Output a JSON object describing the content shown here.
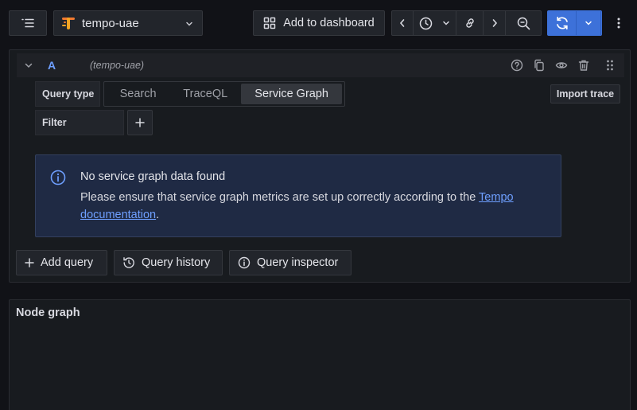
{
  "toolbar": {
    "datasource": {
      "name": "tempo-uae",
      "icon": "tempo-logo-icon"
    },
    "add_to_dashboard_label": "Add to dashboard",
    "accent_color": "#3d71d9"
  },
  "query": {
    "ref_id": "A",
    "datasource_label": "(tempo-uae)",
    "query_type_label": "Query type",
    "query_type_options": [
      "Search",
      "TraceQL",
      "Service Graph"
    ],
    "query_type_selected": "Service Graph",
    "import_trace_label": "Import trace",
    "filter_label": "Filter"
  },
  "alert": {
    "title": "No service graph data found",
    "body_prefix": "Please ensure that service graph metrics are set up correctly according to the ",
    "link_text_1": "Tempo",
    "link_text_2": "documentation",
    "body_suffix": "."
  },
  "actions": {
    "add_query_label": "Add query",
    "query_history_label": "Query history",
    "query_inspector_label": "Query inspector"
  },
  "node_graph": {
    "title": "Node graph"
  }
}
